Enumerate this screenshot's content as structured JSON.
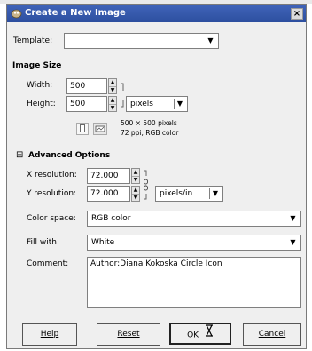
{
  "dialog": {
    "title": "Create a New Image",
    "close_glyph": "×"
  },
  "template": {
    "label": "Template:",
    "value": ""
  },
  "image_size": {
    "heading": "Image Size",
    "width_label": "Width:",
    "width_value": "500",
    "height_label": "Height:",
    "height_value": "500",
    "unit_value": "pixels",
    "info_line1": "500 × 500 pixels",
    "info_line2": "72 ppi, RGB color"
  },
  "advanced": {
    "expander_glyph": "⊟",
    "heading": "Advanced Options",
    "x_res_label": "X resolution:",
    "x_res_value": "72.000",
    "y_res_label": "Y resolution:",
    "y_res_value": "72.000",
    "res_unit_value": "pixels/in",
    "color_space_label": "Color space:",
    "color_space_value": "RGB color",
    "fill_label": "Fill with:",
    "fill_value": "White",
    "comment_label": "Comment:",
    "comment_value": "Author:Diana Kokoska Circle Icon"
  },
  "buttons": {
    "help": "Help",
    "reset": "Reset",
    "ok": "OK",
    "cancel": "Cancel"
  },
  "colors": {
    "titlebar": "#2d4f9f",
    "dialog_bg": "#efefef"
  }
}
